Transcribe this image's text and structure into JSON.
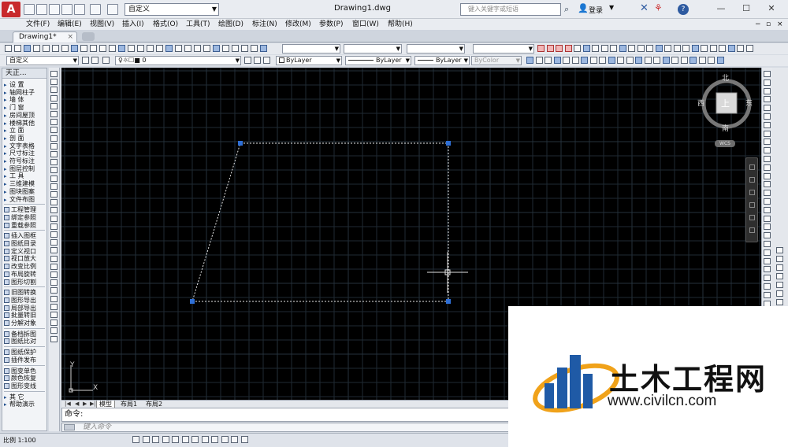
{
  "title_bar": {
    "workspace": "自定义",
    "document_title": "Drawing1.dwg",
    "search_placeholder": "键入关键字或短语",
    "login_label": "登录",
    "help_label": "?"
  },
  "menus": [
    "文件(F)",
    "编辑(E)",
    "视图(V)",
    "插入(I)",
    "格式(O)",
    "工具(T)",
    "绘图(D)",
    "标注(N)",
    "修改(M)",
    "参数(P)",
    "窗口(W)",
    "帮助(H)"
  ],
  "file_tab": {
    "label": "Drawing1*",
    "close": "×"
  },
  "toolbar": {
    "layer_style": "自定义",
    "layer_name": "0",
    "color": "ByLayer",
    "linetype": "ByLayer",
    "lineweight": "ByLayer",
    "plotstyle": "ByColor"
  },
  "left_palette": {
    "header": "天正...",
    "items": [
      {
        "label": "设    置",
        "kind": "menu"
      },
      {
        "label": "轴网柱子",
        "kind": "menu"
      },
      {
        "label": "墙    体",
        "kind": "menu"
      },
      {
        "label": "门    窗",
        "kind": "menu"
      },
      {
        "label": "房间屋顶",
        "kind": "menu"
      },
      {
        "label": "楼梯其他",
        "kind": "menu"
      },
      {
        "label": "立    面",
        "kind": "menu"
      },
      {
        "label": "剖    面",
        "kind": "menu"
      },
      {
        "label": "文字表格",
        "kind": "menu"
      },
      {
        "label": "尺寸标注",
        "kind": "menu"
      },
      {
        "label": "符号标注",
        "kind": "menu"
      },
      {
        "label": "图层控制",
        "kind": "menu"
      },
      {
        "label": "工    具",
        "kind": "menu"
      },
      {
        "label": "三维建模",
        "kind": "menu"
      },
      {
        "label": "图块图案",
        "kind": "menu"
      },
      {
        "label": "文件布图",
        "kind": "menu"
      },
      {
        "label": "工程管理",
        "kind": "cmd"
      },
      {
        "label": "绑定参照",
        "kind": "cmd"
      },
      {
        "label": "重载参照",
        "kind": "cmd"
      },
      {
        "label": "插入图框",
        "kind": "cmd"
      },
      {
        "label": "图纸目录",
        "kind": "cmd"
      },
      {
        "label": "定义视口",
        "kind": "cmd"
      },
      {
        "label": "视口放大",
        "kind": "cmd"
      },
      {
        "label": "改变比例",
        "kind": "cmd"
      },
      {
        "label": "布局旋转",
        "kind": "cmd"
      },
      {
        "label": "图形切割",
        "kind": "cmd"
      },
      {
        "label": "旧图转换",
        "kind": "cmd"
      },
      {
        "label": "图形导出",
        "kind": "cmd"
      },
      {
        "label": "局部导出",
        "kind": "cmd"
      },
      {
        "label": "批量转旧",
        "kind": "cmd"
      },
      {
        "label": "分解对象",
        "kind": "cmd"
      },
      {
        "label": "备档拆图",
        "kind": "cmd"
      },
      {
        "label": "图纸比对",
        "kind": "cmd"
      },
      {
        "label": "图纸保护",
        "kind": "cmd"
      },
      {
        "label": "插件发布",
        "kind": "cmd"
      },
      {
        "label": "图变单色",
        "kind": "cmd"
      },
      {
        "label": "颜色恢复",
        "kind": "cmd"
      },
      {
        "label": "图形变线",
        "kind": "cmd"
      },
      {
        "label": "其    它",
        "kind": "menu"
      },
      {
        "label": "帮助演示",
        "kind": "menu"
      }
    ]
  },
  "viewcube": {
    "north": "北",
    "south": "南",
    "east": "东",
    "west": "西",
    "face": "上",
    "wcs": "WCS"
  },
  "ucs": {
    "x": "X",
    "y": "Y"
  },
  "layout_tabs": {
    "nav": [
      "|◀",
      "◀",
      "▶",
      "▶|"
    ],
    "tabs": [
      "模型",
      "布局1",
      "布局2"
    ],
    "active": "模型"
  },
  "command": {
    "history": "命令:",
    "placeholder": "键入命令"
  },
  "statusbar": {
    "scale": "比例 1:100"
  },
  "watermark": {
    "name": "土木工程网",
    "url": "www.civilcn.com"
  },
  "colors": {
    "canvas": "#000000",
    "grid": "#1f2a33",
    "grid_major": "#26323d",
    "shape": "#e6e6e6",
    "grip": "#2f6fd6",
    "brand_red": "#c8282b"
  }
}
